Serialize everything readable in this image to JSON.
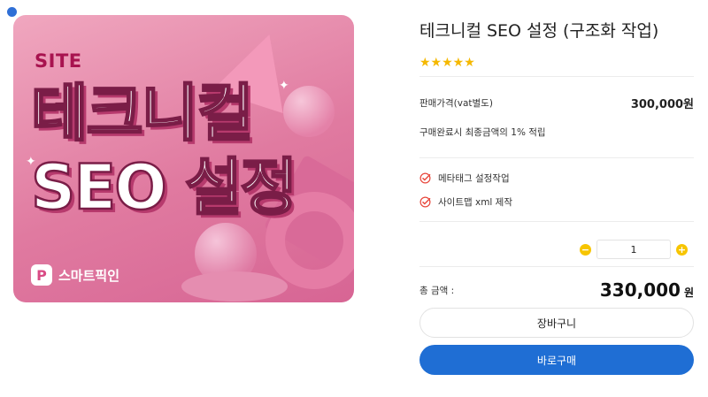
{
  "image": {
    "site_label": "SITE",
    "headline_line1": "테크니컬",
    "headline_line2": "SEO 설정",
    "brand_mark": "P",
    "brand_name": "스마트픽인"
  },
  "product": {
    "title": "테크니컬 SEO 설정 (구조화 작업)",
    "rating_stars": "★★★★★",
    "rating_value": 5,
    "price_label": "판매가격(vat별도)",
    "price_value": "300,000원",
    "points_note": "구매완료시 최종금액의 1% 적립",
    "features": [
      "메타태그 설정작업",
      "사이트맵 xml 제작"
    ],
    "quantity": {
      "minus": "−",
      "value": "1",
      "plus": "+"
    },
    "total_label": "총 금액 :",
    "total_value": "330,000",
    "total_unit": "원",
    "cart_button": "장바구니",
    "buy_button": "바로구매"
  },
  "colors": {
    "accent_blue": "#1f6ed4",
    "star_yellow": "#f5b800",
    "check_red": "#e8473c",
    "image_pink": "#e07aa0"
  }
}
